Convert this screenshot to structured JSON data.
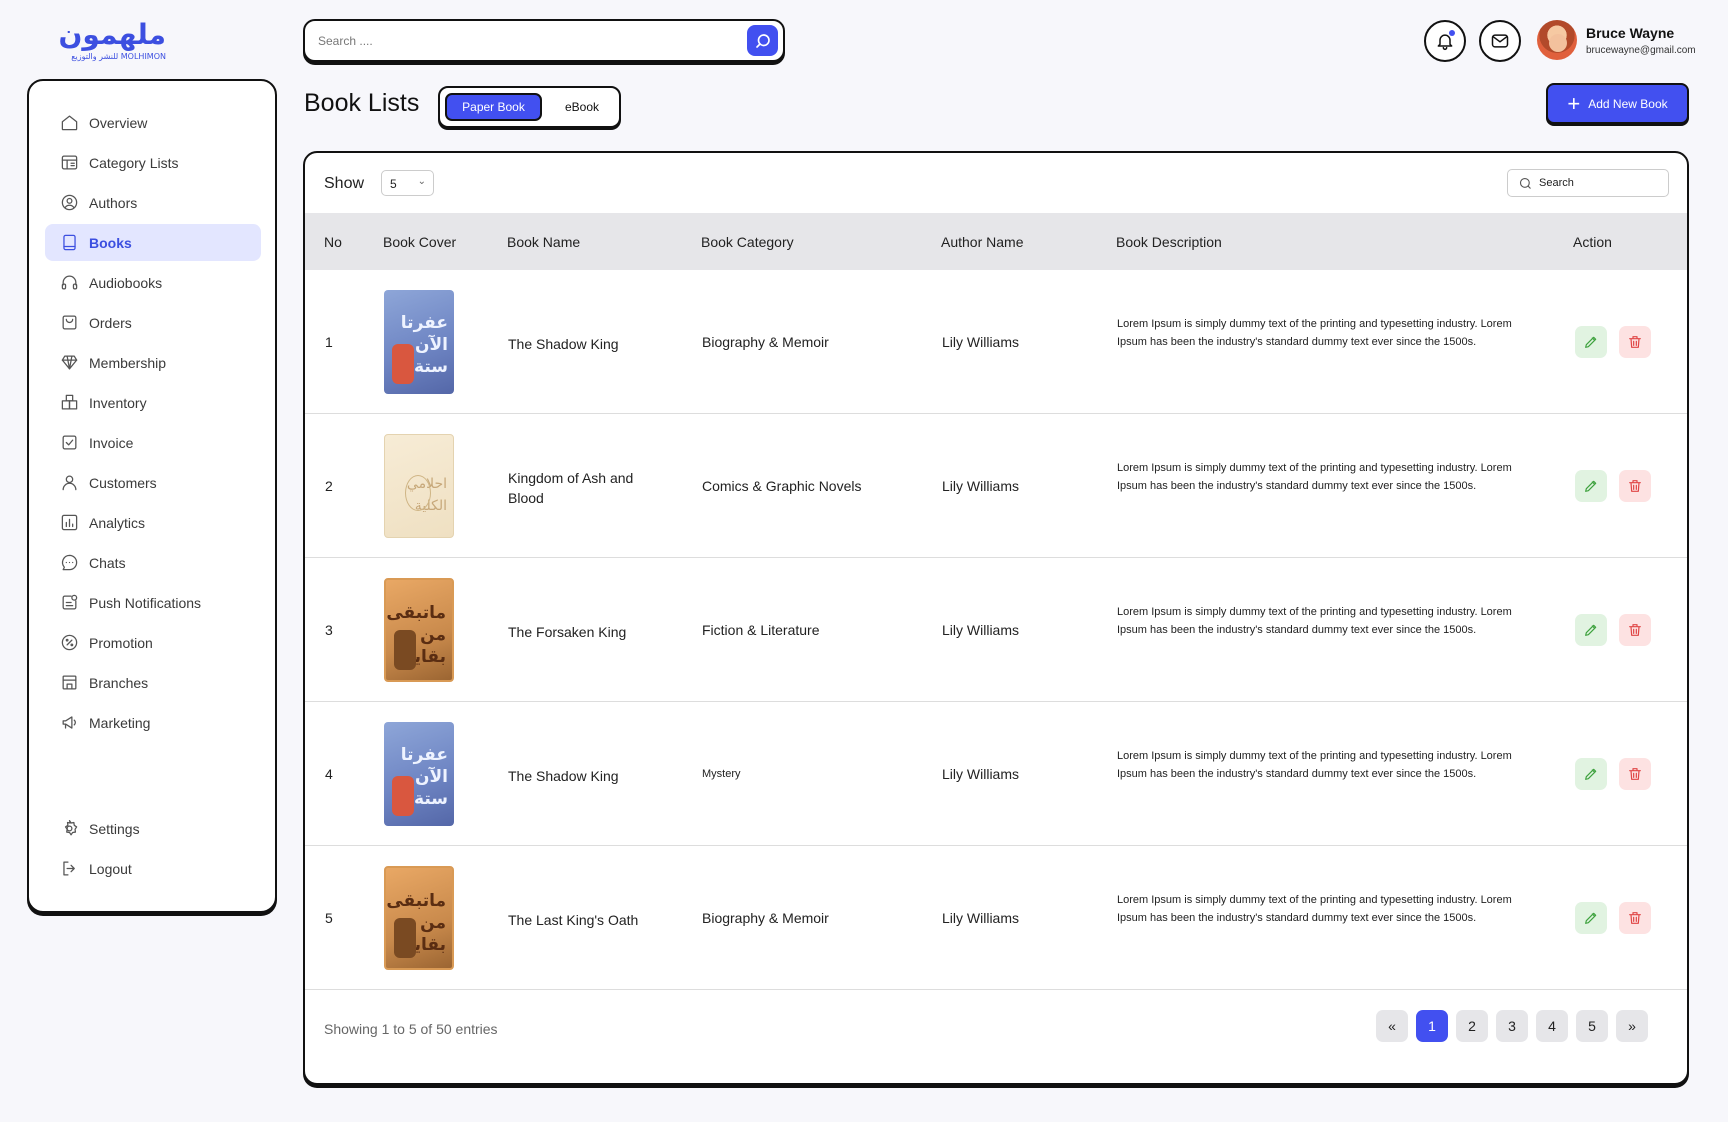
{
  "brand": {
    "logo_text": "ملهمون",
    "logo_subtext": "للنشر والتوزيع MOLHIMON",
    "primary_color": "#4250f0"
  },
  "header": {
    "search_placeholder": "Search ....",
    "user_name": "Bruce Wayne",
    "user_email": "brucewayne@gmail.com"
  },
  "sidebar": {
    "items": [
      {
        "label": "Overview",
        "icon": "home-icon"
      },
      {
        "label": "Category Lists",
        "icon": "category-icon"
      },
      {
        "label": "Authors",
        "icon": "user-circle-icon"
      },
      {
        "label": "Books",
        "icon": "book-icon",
        "active": true
      },
      {
        "label": "Audiobooks",
        "icon": "headphones-icon"
      },
      {
        "label": "Orders",
        "icon": "bag-icon"
      },
      {
        "label": "Membership",
        "icon": "diamond-icon"
      },
      {
        "label": "Inventory",
        "icon": "boxes-icon"
      },
      {
        "label": "Invoice",
        "icon": "invoice-icon"
      },
      {
        "label": "Customers",
        "icon": "person-icon"
      },
      {
        "label": "Analytics",
        "icon": "chart-icon"
      },
      {
        "label": "Chats",
        "icon": "chat-icon"
      },
      {
        "label": "Push Notifications",
        "icon": "notification-icon"
      },
      {
        "label": "Promotion",
        "icon": "percent-icon"
      },
      {
        "label": "Branches",
        "icon": "store-icon"
      },
      {
        "label": "Marketing",
        "icon": "megaphone-icon"
      }
    ],
    "bottom": [
      {
        "label": "Settings",
        "icon": "gear-icon"
      },
      {
        "label": "Logout",
        "icon": "logout-icon"
      }
    ]
  },
  "page": {
    "title": "Book Lists",
    "tabs": [
      "Paper Book",
      "eBook"
    ],
    "active_tab": "Paper Book",
    "add_button": "Add New Book"
  },
  "table": {
    "show_label": "Show",
    "show_value": "5",
    "search_label": "Search",
    "columns": [
      "No",
      "Book Cover",
      "Book Name",
      "Book Category",
      "Author Name",
      "Book Description",
      "Action"
    ],
    "rows": [
      {
        "no": "1",
        "cover_title": "عفرتا الآن ستة",
        "name": "The Shadow King",
        "category": "Biography & Memoir",
        "author": "Lily Williams",
        "description": "Lorem Ipsum is simply dummy text of the printing and typesetting industry. Lorem Ipsum has been the industry's standard dummy text ever since the 1500s."
      },
      {
        "no": "2",
        "cover_title": "احلامي الكلية",
        "name": "Kingdom of Ash and Blood",
        "category": "Comics & Graphic Novels",
        "author": "Lily Williams",
        "description": "Lorem Ipsum is simply dummy text of the printing and typesetting industry. Lorem Ipsum has been the industry's standard dummy text ever since the 1500s."
      },
      {
        "no": "3",
        "cover_title": "ماتبقى من بقايا",
        "name": "The Forsaken King",
        "category": "Fiction & Literature",
        "author": "Lily Williams",
        "description": "Lorem Ipsum is simply dummy text of the printing and typesetting industry. Lorem Ipsum has been the industry's standard dummy text ever since the 1500s."
      },
      {
        "no": "4",
        "cover_title": "عفرتا الآن ستة",
        "name": "The Shadow King",
        "category": "Mystery",
        "author": "Lily Williams",
        "description": "Lorem Ipsum is simply dummy text of the printing and typesetting industry. Lorem Ipsum has been the industry's standard dummy text ever since the 1500s."
      },
      {
        "no": "5",
        "cover_title": "ماتبقى من بقايا",
        "name": "The Last King's Oath",
        "category": "Biography & Memoir",
        "author": "Lily Williams",
        "description": "Lorem Ipsum is simply dummy text of the printing and typesetting industry. Lorem Ipsum has been the industry's standard dummy text ever since the 1500s."
      }
    ],
    "footer": {
      "showing": "Showing 1 to 5 of 50 entries",
      "first": "«",
      "pages": [
        "1",
        "2",
        "3",
        "4",
        "5"
      ],
      "active_page": "1",
      "last": "»"
    }
  }
}
